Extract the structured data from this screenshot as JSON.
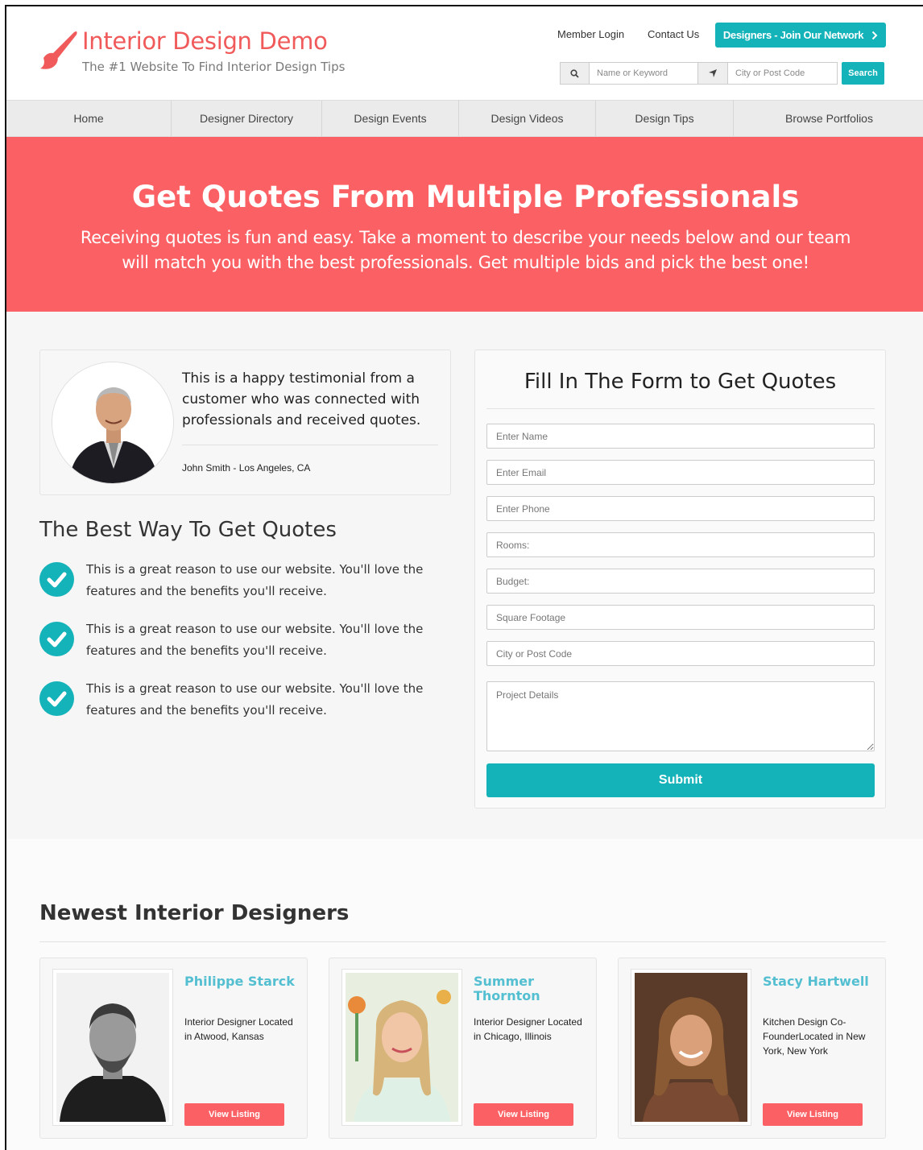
{
  "header": {
    "logo_title": "Interior Design Demo",
    "logo_tagline": "The #1 Website To Find Interior Design Tips",
    "member_login": "Member Login",
    "contact_us": "Contact Us",
    "join_button": "Designers - Join Our Network",
    "search": {
      "keyword_placeholder": "Name or Keyword",
      "location_placeholder": "City or Post Code",
      "button": "Search"
    }
  },
  "nav": {
    "items": [
      {
        "label": "Home"
      },
      {
        "label": "Designer Directory"
      },
      {
        "label": "Design Events"
      },
      {
        "label": "Design Videos"
      },
      {
        "label": "Design Tips"
      },
      {
        "label": "Browse Portfolios"
      }
    ]
  },
  "hero": {
    "title": "Get Quotes From Multiple Professionals",
    "subtitle": "Receiving quotes is fun and easy. Take a moment to describe your needs below and our team will match you with the best professionals. Get multiple bids and pick the best one!"
  },
  "testimonial": {
    "quote": "This is a happy testimonial from a customer who was connected with professionals and received quotes.",
    "author": "John Smith - Los Angeles, CA"
  },
  "benefits": {
    "title": "The Best Way To Get Quotes",
    "items": [
      {
        "text": "This is a great reason to use our website. You'll love the features and the benefits you'll receive."
      },
      {
        "text": "This is a great reason to use our website. You'll love the features and the benefits you'll receive."
      },
      {
        "text": "This is a great reason to use our website. You'll love the features and the benefits you'll receive."
      }
    ]
  },
  "form": {
    "title": "Fill In The Form to Get Quotes",
    "fields": {
      "name": "Enter Name",
      "email": "Enter Email",
      "phone": "Enter Phone",
      "rooms": "Rooms:",
      "budget": "Budget:",
      "square_footage": "Square Footage",
      "city": "City or Post Code",
      "details": "Project Details"
    },
    "submit": "Submit"
  },
  "newest": {
    "title": "Newest Interior Designers",
    "designers": [
      {
        "name": "Philippe Starck",
        "description": "Interior Designer Located in Atwood, Kansas",
        "button": "View Listing"
      },
      {
        "name": "Summer Thornton",
        "description": "Interior Designer Located in Chicago, Illinois",
        "button": "View Listing"
      },
      {
        "name": "Stacy Hartwell",
        "description": "Kitchen Design Co-FounderLocated in New York, New York",
        "button": "View Listing"
      }
    ]
  },
  "colors": {
    "brand_red": "#fb6164",
    "accent_teal": "#14b2b9",
    "link_blue": "#53bfd1"
  }
}
